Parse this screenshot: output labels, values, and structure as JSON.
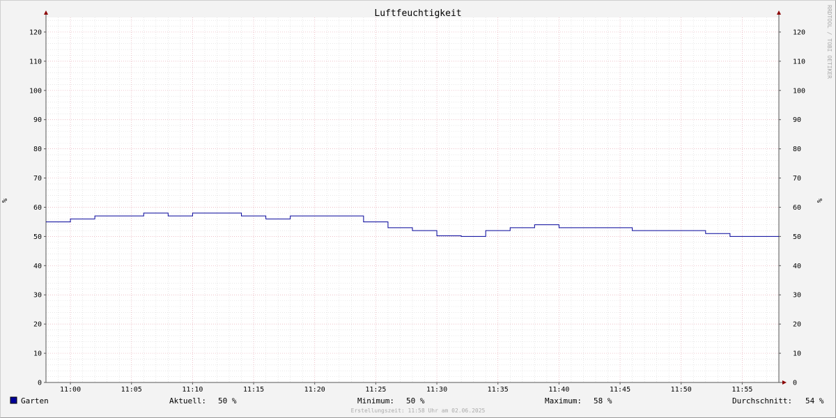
{
  "chart_data": {
    "type": "line",
    "title": "Luftfeuchtigkeit",
    "ylabel": "%",
    "ylabel_right": "%",
    "ylim": [
      0,
      125
    ],
    "yticks": [
      0,
      10,
      20,
      30,
      40,
      50,
      60,
      70,
      80,
      90,
      100,
      110,
      120
    ],
    "xlim": [
      "10:58",
      "11:58"
    ],
    "xticks": [
      "11:00",
      "11:05",
      "11:10",
      "11:15",
      "11:20",
      "11:25",
      "11:30",
      "11:35",
      "11:40",
      "11:45",
      "11:50",
      "11:55"
    ],
    "grid": true,
    "series": [
      {
        "name": "Garten",
        "color": "#000099",
        "step": true,
        "points": [
          [
            "10:58",
            55
          ],
          [
            "11:00",
            56
          ],
          [
            "11:02",
            57
          ],
          [
            "11:06",
            58
          ],
          [
            "11:08",
            57
          ],
          [
            "11:10",
            58
          ],
          [
            "11:14",
            57
          ],
          [
            "11:16",
            56
          ],
          [
            "11:18",
            57
          ],
          [
            "11:24",
            55
          ],
          [
            "11:26",
            53
          ],
          [
            "11:28",
            52
          ],
          [
            "11:30",
            50.2
          ],
          [
            "11:32",
            50
          ],
          [
            "11:34",
            52
          ],
          [
            "11:36",
            53
          ],
          [
            "11:38",
            54
          ],
          [
            "11:40",
            53
          ],
          [
            "11:46",
            52
          ],
          [
            "11:52",
            51
          ],
          [
            "11:54",
            50
          ],
          [
            "11:58",
            50
          ]
        ]
      }
    ],
    "watermark": "RRDTOOL / TOBI OETIKER",
    "legend": {
      "series_label": "Garten",
      "color": "#000099",
      "stats": [
        {
          "label": "Aktuell:",
          "value": "50 %"
        },
        {
          "label": "Minimum:",
          "value": "50 %"
        },
        {
          "label": "Maximum:",
          "value": "58 %"
        },
        {
          "label": "Durchschnitt:",
          "value": "54 %"
        }
      ]
    },
    "footer": "Erstellungszeit: 11:58 Uhr am 02.06.2025"
  }
}
